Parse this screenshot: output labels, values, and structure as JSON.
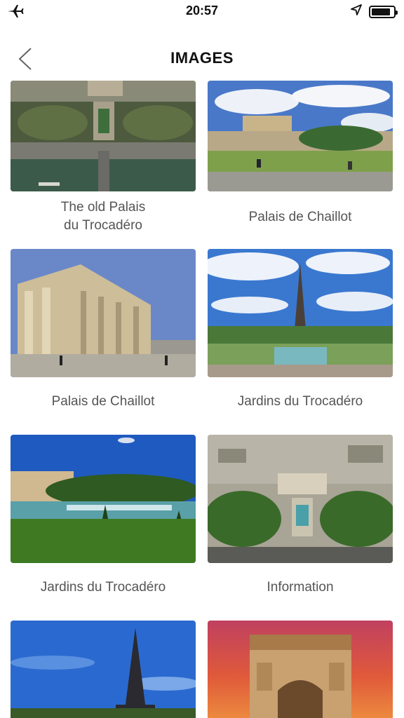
{
  "status_bar": {
    "time": "20:57",
    "icons": [
      "airplane-icon",
      "location-arrow-icon",
      "battery-icon"
    ]
  },
  "header": {
    "title": "IMAGES",
    "back_icon": "chevron-left-icon"
  },
  "gallery": {
    "items": [
      {
        "caption": "The old Palais\ndu Trocadéro",
        "image": "aerial view of Trocadéro gardens and the Seine"
      },
      {
        "caption": "Palais de Chaillot",
        "image": "Palais de Chaillot under a cloudy blue sky"
      },
      {
        "caption": "Palais de Chaillot",
        "image": "Palais de Chaillot colonnade facade"
      },
      {
        "caption": "Jardins du Trocadéro",
        "image": "Eiffel Tower seen from the Trocadéro fountains"
      },
      {
        "caption": "Jardins du Trocadéro",
        "image": "fountains and lawn in front of Palais de Chaillot"
      },
      {
        "caption": "Information",
        "image": "aerial view of Paris and Trocadéro"
      },
      {
        "caption": "",
        "image": "Eiffel Tower against blue sky"
      },
      {
        "caption": "",
        "image": "Arc de Triomphe at sunset"
      }
    ]
  }
}
